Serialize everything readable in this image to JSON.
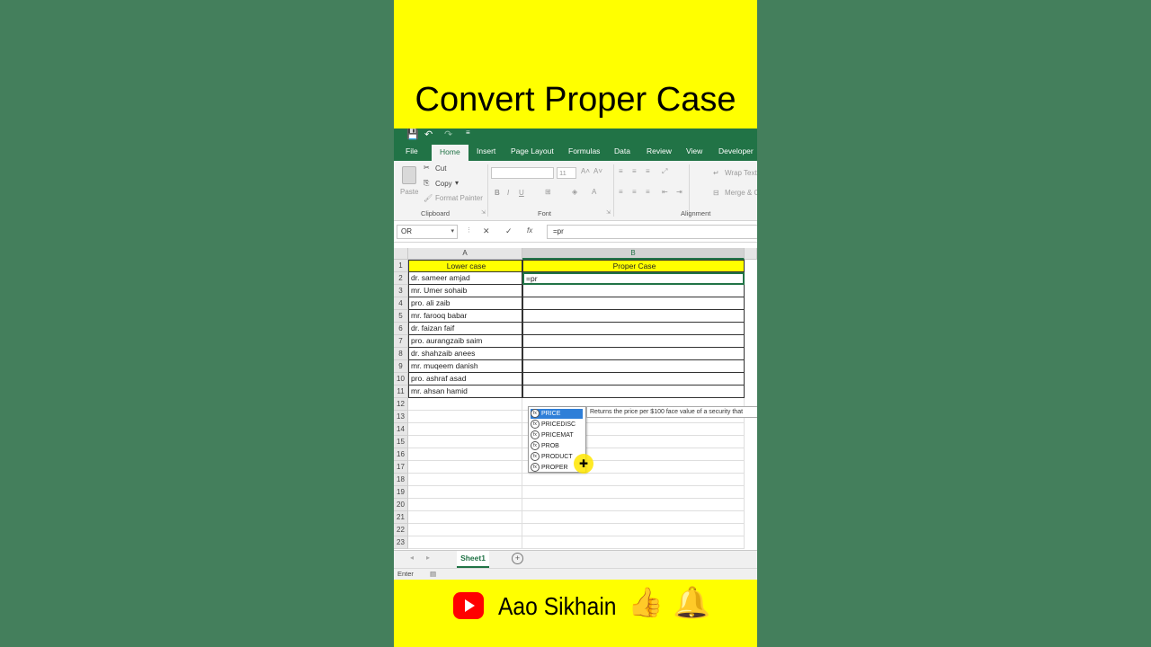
{
  "title": "Convert Proper Case",
  "ribbon": {
    "qat": [
      "💾",
      "↶",
      "↷",
      "≡"
    ],
    "tabs": [
      "File",
      "Home",
      "Insert",
      "Page Layout",
      "Formulas",
      "Data",
      "Review",
      "View",
      "Developer"
    ],
    "clipboard": {
      "paste": "Paste",
      "cut": "Cut",
      "copy": "Copy",
      "format_painter": "Format Painter",
      "group": "Clipboard"
    },
    "font": {
      "size": "11",
      "bold": "B",
      "italic": "I",
      "underline": "U",
      "group": "Font"
    },
    "alignment": {
      "wrap_text": "Wrap Text",
      "merge": "Merge & C",
      "group": "Alignment"
    }
  },
  "formula_bar": {
    "name_box": "OR",
    "cancel": "✕",
    "enter": "✓",
    "fx": "fx",
    "value": "=pr"
  },
  "grid": {
    "columns": [
      "A",
      "B"
    ],
    "rows": [
      "1",
      "2",
      "3",
      "4",
      "5",
      "6",
      "7",
      "8",
      "9",
      "10",
      "11",
      "12",
      "13",
      "14",
      "15",
      "16",
      "17",
      "18",
      "19",
      "20",
      "21",
      "22",
      "23"
    ],
    "headers": {
      "a": "Lower case",
      "b": "Proper  Case"
    },
    "active_cell_text": "=pr",
    "names": [
      "dr. sameer amjad",
      "mr. Umer sohaib",
      "pro. ali zaib",
      "mr. farooq babar",
      "dr. faizan faif",
      "pro. aurangzaib saim",
      "dr. shahzaib anees",
      "mr. muqeem danish",
      "pro. ashraf asad",
      "mr. ahsan hamid"
    ]
  },
  "autocomplete": {
    "items": [
      "PRICE",
      "PRICEDISC",
      "PRICEMAT",
      "PROB",
      "PRODUCT",
      "PROPER"
    ],
    "icon": "fx",
    "selected_index": 0,
    "tooltip": "Returns the price per $100 face value of a security that"
  },
  "sheet": {
    "tab": "Sheet1",
    "add": "+",
    "status": "Enter"
  },
  "footer": {
    "brand": "Aao Sikhain",
    "thumb": "👍",
    "bell": "🔔"
  },
  "colors": {
    "excel_green": "#217346",
    "highlight_yellow": "#ffff00",
    "background": "#447f5c"
  }
}
